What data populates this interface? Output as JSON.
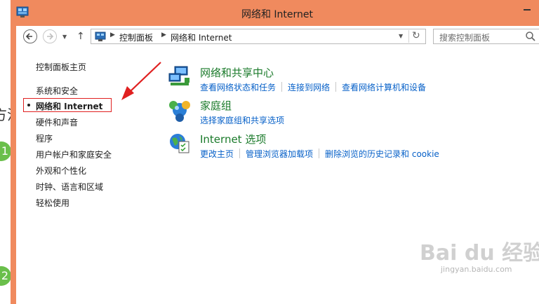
{
  "background": {
    "partial_text": "方法",
    "steps": [
      "1",
      "2"
    ]
  },
  "window": {
    "title": "网络和 Internet",
    "minimize_glyph": "—"
  },
  "navbar": {
    "back_glyph": "←",
    "forward_glyph": "→",
    "dropdown_glyph": "▼",
    "up_glyph": "↑",
    "breadcrumb": [
      "控制面板",
      "网络和 Internet"
    ],
    "breadcrumb_sep": "▶",
    "refresh_glyph": "↻",
    "search_placeholder": "搜索控制面板"
  },
  "sidebar": {
    "home": "控制面板主页",
    "items": [
      {
        "label": "系统和安全",
        "active": false
      },
      {
        "label": "网络和 Internet",
        "active": true
      },
      {
        "label": "硬件和声音",
        "active": false
      },
      {
        "label": "程序",
        "active": false
      },
      {
        "label": "用户帐户和家庭安全",
        "active": false
      },
      {
        "label": "外观和个性化",
        "active": false
      },
      {
        "label": "时钟、语言和区域",
        "active": false
      },
      {
        "label": "轻松使用",
        "active": false
      }
    ]
  },
  "categories": [
    {
      "title": "网络和共享中心",
      "icon": "network-center-icon",
      "links": [
        "查看网络状态和任务",
        "连接到网络",
        "查看网络计算机和设备"
      ]
    },
    {
      "title": "家庭组",
      "icon": "homegroup-icon",
      "links": [
        "选择家庭组和共享选项"
      ]
    },
    {
      "title": "Internet 选项",
      "icon": "internet-options-icon",
      "links": [
        "更改主页",
        "管理浏览器加载项",
        "删除浏览的历史记录和 cookie"
      ]
    }
  ],
  "watermark": {
    "text": "Bai du 经验",
    "sub": "jingyan.baidu.com"
  },
  "colors": {
    "titlebar": "#f08a5e",
    "link": "#0660c8",
    "category_title": "#1a7a2a",
    "highlight_box": "#e02020"
  }
}
